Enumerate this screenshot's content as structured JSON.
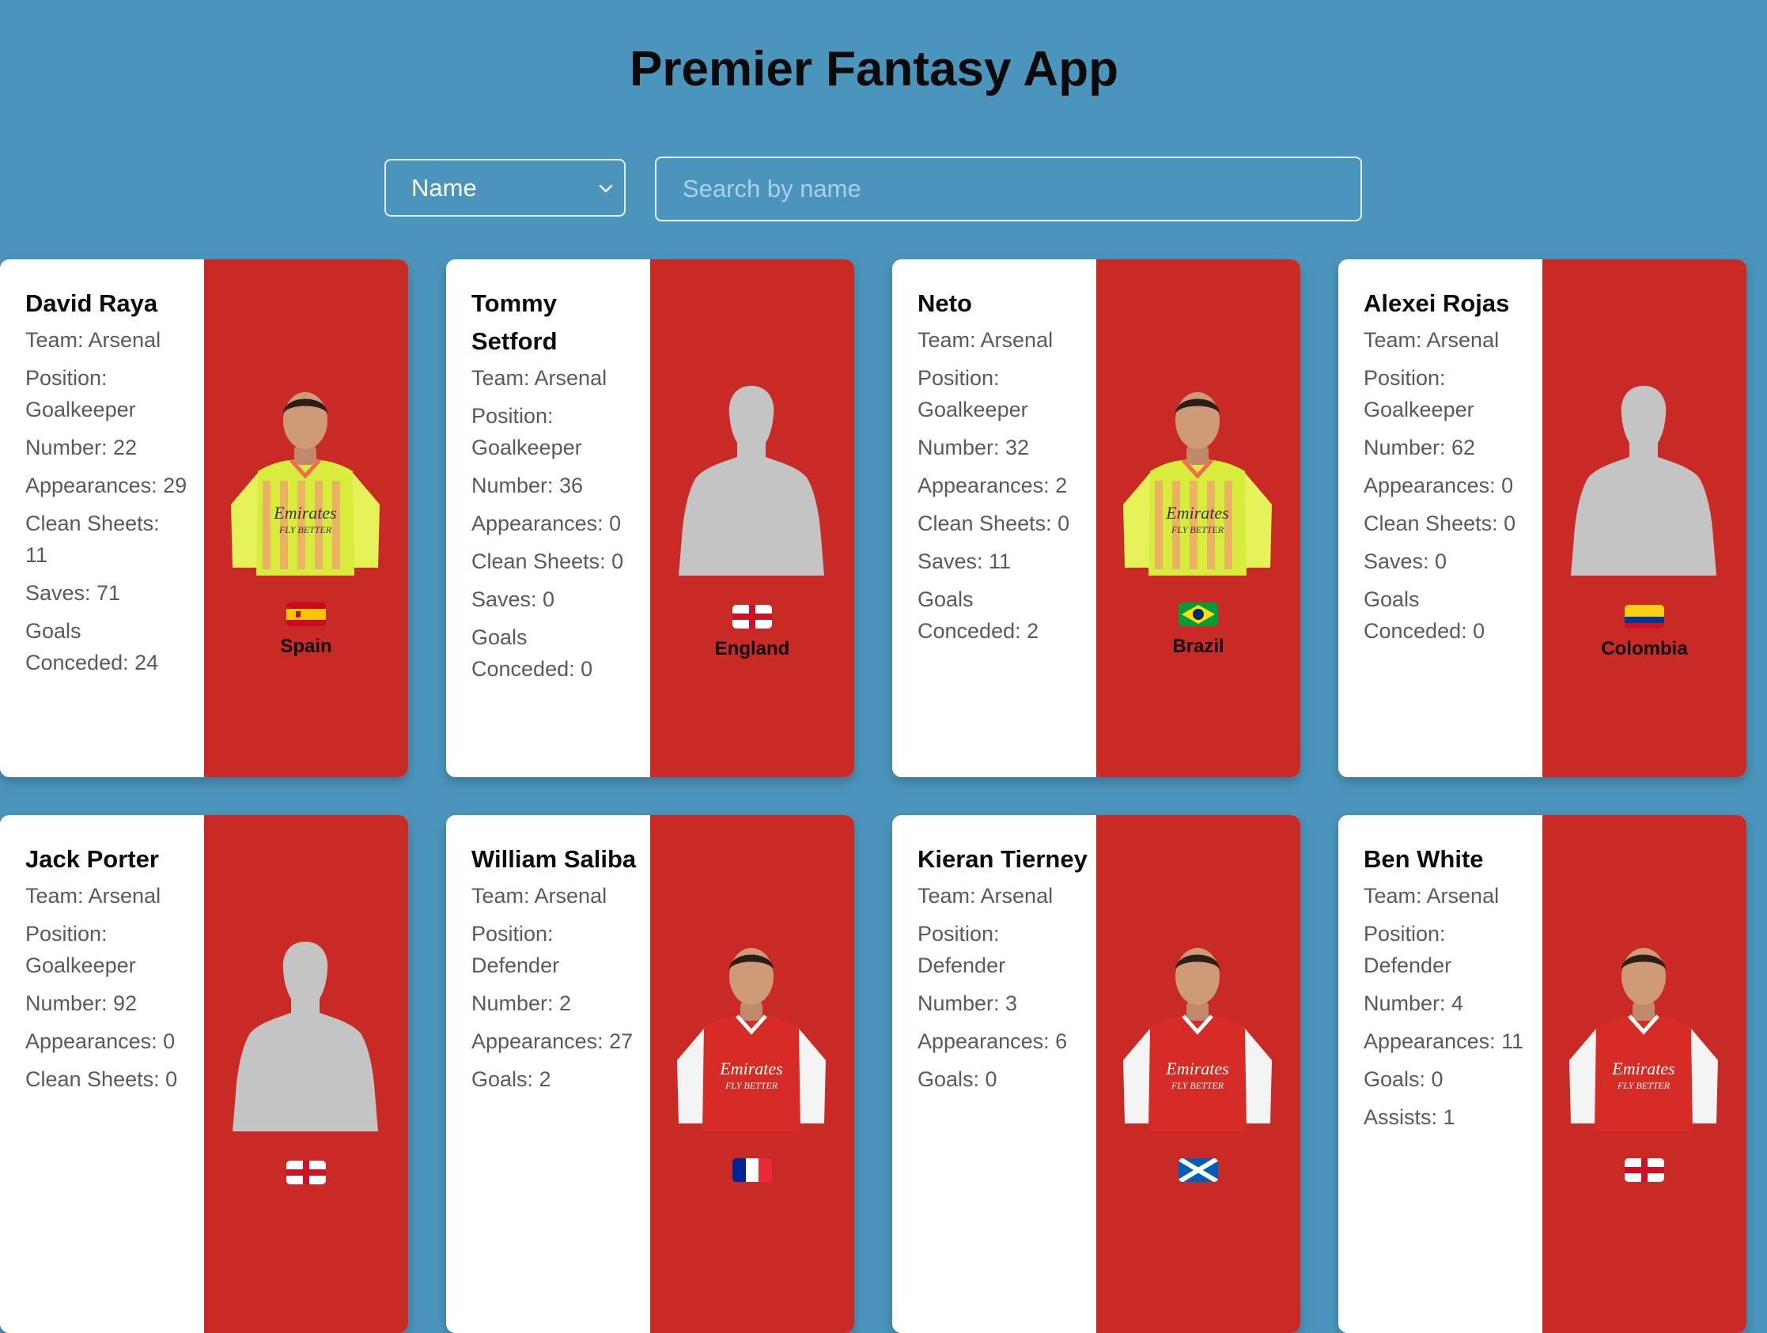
{
  "app": {
    "title": "Premier Fantasy App",
    "sort_select": {
      "selected": "Name",
      "icon": "chevron-down-icon"
    },
    "search": {
      "placeholder": "Search by name"
    }
  },
  "colors": {
    "page_background": "#4b95bc",
    "card_accent": "#c92a25",
    "card_info_background": "#ffffff"
  },
  "players": [
    {
      "name": "David Raya",
      "stats": [
        "Team: Arsenal",
        "Position: Goalkeeper",
        "Number: 22",
        "Appearances: 29",
        "Clean Sheets: 11",
        "Saves: 71",
        "Goals Conceded: 24"
      ],
      "country": "Spain",
      "photo": "goalkeeper-kit",
      "flag": "spain-flag-icon"
    },
    {
      "name": "Tommy Setford",
      "stats": [
        "Team: Arsenal",
        "Position: Goalkeeper",
        "Number: 36",
        "Appearances: 0",
        "Clean Sheets: 0",
        "Saves: 0",
        "Goals Conceded: 0"
      ],
      "country": "England",
      "photo": "silhouette",
      "flag": "england-flag-icon"
    },
    {
      "name": "Neto",
      "stats": [
        "Team: Arsenal",
        "Position: Goalkeeper",
        "Number: 32",
        "Appearances: 2",
        "Clean Sheets: 0",
        "Saves: 11",
        "Goals Conceded: 2"
      ],
      "country": "Brazil",
      "photo": "goalkeeper-kit",
      "flag": "brazil-flag-icon"
    },
    {
      "name": "Alexei Rojas",
      "stats": [
        "Team: Arsenal",
        "Position: Goalkeeper",
        "Number: 62",
        "Appearances: 0",
        "Clean Sheets: 0",
        "Saves: 0",
        "Goals Conceded: 0"
      ],
      "country": "Colombia",
      "photo": "silhouette",
      "flag": "colombia-flag-icon"
    },
    {
      "name": "Jack Porter",
      "stats": [
        "Team: Arsenal",
        "Position: Goalkeeper",
        "Number: 92",
        "Appearances: 0",
        "Clean Sheets: 0"
      ],
      "country": "",
      "photo": "silhouette",
      "flag": "england-flag-icon"
    },
    {
      "name": "William Saliba",
      "stats": [
        "Team: Arsenal",
        "Position: Defender",
        "Number: 2",
        "Appearances: 27",
        "Goals: 2"
      ],
      "country": "",
      "photo": "home-kit",
      "flag": "france-flag-icon"
    },
    {
      "name": "Kieran Tierney",
      "stats": [
        "Team: Arsenal",
        "Position: Defender",
        "Number: 3",
        "Appearances: 6",
        "Goals: 0"
      ],
      "country": "",
      "photo": "home-kit",
      "flag": "scotland-flag-icon"
    },
    {
      "name": "Ben White",
      "stats": [
        "Team: Arsenal",
        "Position: Defender",
        "Number: 4",
        "Appearances: 11",
        "Goals: 0",
        "Assists: 1"
      ],
      "country": "",
      "photo": "home-kit",
      "flag": "england-flag-icon"
    }
  ]
}
